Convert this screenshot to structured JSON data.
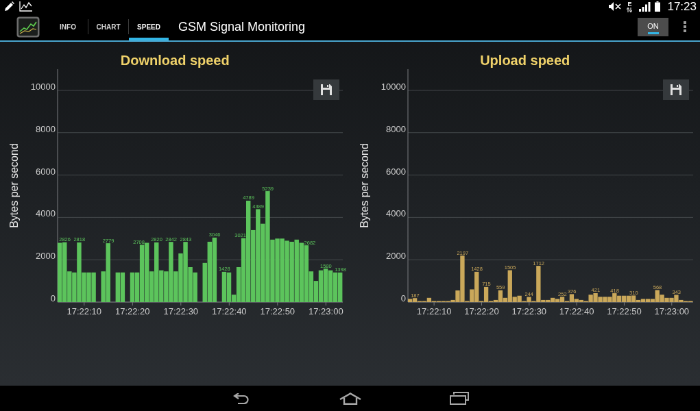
{
  "status_bar": {
    "network_type": "E",
    "time": "17:23"
  },
  "action_bar": {
    "tabs": [
      {
        "label": "INFO",
        "selected": false
      },
      {
        "label": "CHART",
        "selected": false
      },
      {
        "label": "SPEED",
        "selected": true
      }
    ],
    "title": "GSM Signal Monitoring",
    "toggle": {
      "label": "ON",
      "on": true
    }
  },
  "charts": [
    {
      "chart_data": {
        "type": "bar",
        "title": "Download speed",
        "ylabel": "Bytes per second",
        "categories": [
          null,
          null,
          null,
          null,
          null,
          "17:22:10",
          null,
          null,
          null,
          null,
          null,
          null,
          null,
          null,
          null,
          "17:22:20",
          null,
          null,
          null,
          null,
          null,
          null,
          null,
          null,
          null,
          "17:22:30",
          null,
          null,
          null,
          null,
          null,
          null,
          null,
          null,
          null,
          "17:22:40",
          null,
          null,
          null,
          null,
          null,
          null,
          null,
          null,
          null,
          "17:22:50",
          null,
          null,
          null,
          null,
          null,
          null,
          null,
          null,
          null,
          "17:23:00",
          null,
          null,
          null
        ],
        "series": [
          {
            "color": "#5cc45c",
            "values": [
              2800,
              2826,
              1450,
              1400,
              2818,
              1400,
              1400,
              1400,
              0,
              1450,
              2779,
              0,
              1400,
              1400,
              0,
              1400,
              1400,
              2708,
              2800,
              1450,
              2820,
              1500,
              1450,
              2842,
              1450,
              2300,
              2843,
              1650,
              1400,
              0,
              1850,
              2850,
              3046,
              0,
              1428,
              1400,
              350,
              1650,
              3021,
              4789,
              3400,
              4389,
              3700,
              5239,
              2950,
              3000,
              3000,
              2900,
              2850,
              2950,
              2800,
              2682,
              1450,
              1000,
              1500,
              1580,
              1500,
              1400,
              1398
            ]
          }
        ],
        "ylim": [
          0,
          11000
        ],
        "yticks": [
          0,
          2000,
          4000,
          6000,
          8000,
          10000
        ],
        "grid": true,
        "value_labels": [
          null,
          "2826",
          null,
          null,
          "2818",
          null,
          null,
          null,
          null,
          null,
          "2779",
          null,
          null,
          null,
          null,
          null,
          null,
          "2708",
          null,
          null,
          "2820",
          null,
          null,
          "2842",
          null,
          null,
          "2843",
          null,
          null,
          null,
          null,
          null,
          "3046",
          null,
          "1428",
          null,
          null,
          null,
          "3021",
          "4789",
          null,
          "4389",
          null,
          "5239",
          null,
          null,
          null,
          null,
          null,
          null,
          null,
          "2682",
          null,
          null,
          null,
          "1580",
          null,
          null,
          "1398"
        ]
      }
    },
    {
      "chart_data": {
        "type": "bar",
        "title": "Upload speed",
        "ylabel": "Bytes per second",
        "categories": [
          null,
          null,
          null,
          null,
          null,
          "17:22:10",
          null,
          null,
          null,
          null,
          null,
          null,
          null,
          null,
          null,
          "17:22:20",
          null,
          null,
          null,
          null,
          null,
          null,
          null,
          null,
          null,
          "17:22:30",
          null,
          null,
          null,
          null,
          null,
          null,
          null,
          null,
          null,
          "17:22:40",
          null,
          null,
          null,
          null,
          null,
          null,
          null,
          null,
          null,
          "17:22:50",
          null,
          null,
          null,
          null,
          null,
          null,
          null,
          null,
          null,
          "17:23:00",
          null,
          null,
          null,
          null
        ],
        "series": [
          {
            "color": "#caa85a",
            "values": [
              150,
              187,
              50,
              50,
              200,
              50,
              50,
              50,
              50,
              100,
              550,
              2197,
              50,
              600,
              1428,
              50,
              715,
              50,
              100,
              559,
              200,
              1505,
              250,
              300,
              50,
              244,
              50,
              1712,
              100,
              100,
              200,
              150,
              252,
              50,
              376,
              150,
              100,
              50,
              350,
              421,
              250,
              250,
              250,
              418,
              300,
              300,
              300,
              310,
              100,
              150,
              150,
              150,
              568,
              350,
              200,
              200,
              343,
              100,
              50,
              50
            ]
          }
        ],
        "ylim": [
          0,
          11000
        ],
        "yticks": [
          0,
          2000,
          4000,
          6000,
          8000,
          10000
        ],
        "grid": true,
        "value_labels": [
          null,
          "187",
          null,
          null,
          null,
          null,
          null,
          null,
          null,
          null,
          null,
          "2197",
          null,
          null,
          "1428",
          null,
          "715",
          null,
          null,
          "559",
          null,
          "1505",
          null,
          null,
          null,
          "244",
          null,
          "1712",
          null,
          null,
          null,
          null,
          "252",
          null,
          "376",
          null,
          null,
          null,
          null,
          "421",
          null,
          null,
          null,
          "418",
          null,
          null,
          null,
          "310",
          null,
          null,
          null,
          null,
          "568",
          null,
          null,
          null,
          "343",
          null,
          null,
          null
        ]
      }
    }
  ]
}
